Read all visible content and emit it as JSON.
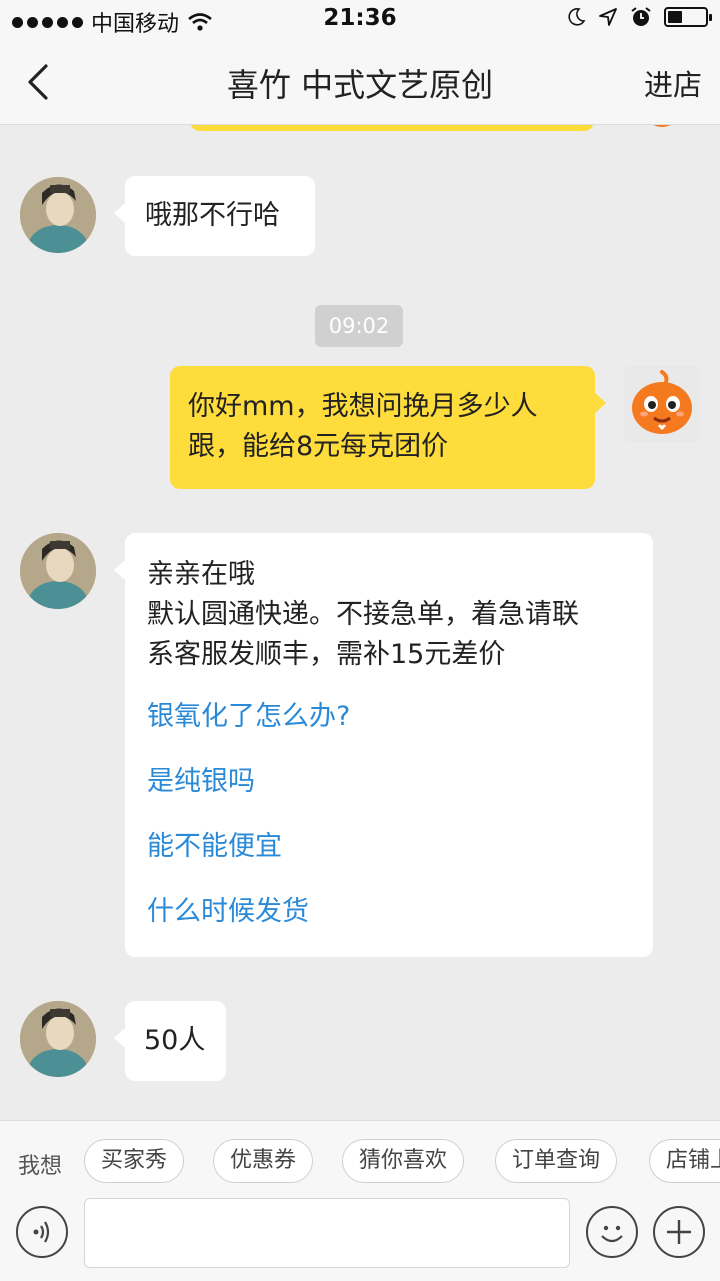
{
  "status_bar": {
    "carrier": "中国移动",
    "time": "21:36",
    "battery_level": 0.4
  },
  "nav": {
    "title": "喜竹 中式文艺原创",
    "shop_label": "进店"
  },
  "chat": {
    "messages": [
      {
        "text": "哦那不行哈"
      },
      {
        "timestamp": "09:02"
      },
      {
        "text": "你好mm，我想问挽月多少人跟，能给8元每克团价"
      },
      {
        "line1": "亲亲在哦",
        "line2": "默认圆通快递。不接急单，着急请联",
        "line3": "系客服发顺丰，需补15元差价",
        "faq": [
          "银氧化了怎么办?",
          "是纯银吗",
          "能不能便宜",
          "什么时候发货"
        ]
      },
      {
        "text": "50人"
      }
    ]
  },
  "quick": {
    "label": "我想",
    "chips": [
      "买家秀",
      "优惠券",
      "猜你喜欢",
      "订单查询",
      "店铺上新"
    ]
  },
  "input": {
    "placeholder": ""
  },
  "colors": {
    "accent_yellow": "#fedc3b",
    "link_blue": "#2a8ad8",
    "background": "#ececec"
  }
}
